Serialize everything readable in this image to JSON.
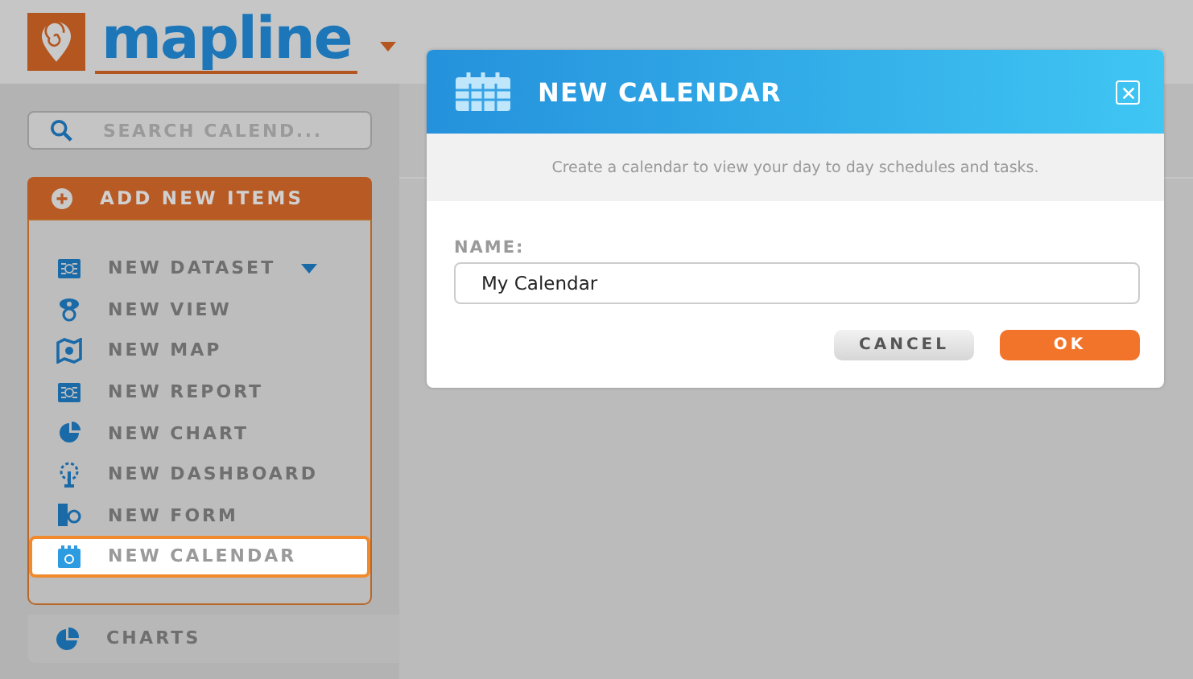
{
  "header": {
    "logo_text": "mapline"
  },
  "sidebar": {
    "search": {
      "placeholder": "SEARCH CALEND..."
    },
    "add_button": "ADD NEW ITEMS",
    "menu": [
      {
        "kind": "dataset",
        "label": "NEW DATASET",
        "selected": false,
        "has_submenu": true
      },
      {
        "kind": "view",
        "label": "NEW VIEW",
        "selected": false,
        "has_submenu": false
      },
      {
        "kind": "map",
        "label": "NEW MAP",
        "selected": false,
        "has_submenu": false
      },
      {
        "kind": "report",
        "label": "NEW REPORT",
        "selected": false,
        "has_submenu": false
      },
      {
        "kind": "chart",
        "label": "NEW CHART",
        "selected": false,
        "has_submenu": false
      },
      {
        "kind": "dashboard",
        "label": "NEW DASHBOARD",
        "selected": false,
        "has_submenu": false
      },
      {
        "kind": "form",
        "label": "NEW FORM",
        "selected": false,
        "has_submenu": false
      },
      {
        "kind": "calendar",
        "label": "NEW CALENDAR",
        "selected": true,
        "has_submenu": false
      }
    ],
    "sections": [
      {
        "label": "CHARTS"
      }
    ]
  },
  "dialog": {
    "title": "NEW CALENDAR",
    "description": "Create a calendar to view your day to day schedules and tasks.",
    "field_label": "NAME:",
    "name_value": "My Calendar",
    "buttons": [
      {
        "kind": "secondary",
        "label": "CANCEL"
      },
      {
        "kind": "primary",
        "label": "OK"
      }
    ]
  }
}
